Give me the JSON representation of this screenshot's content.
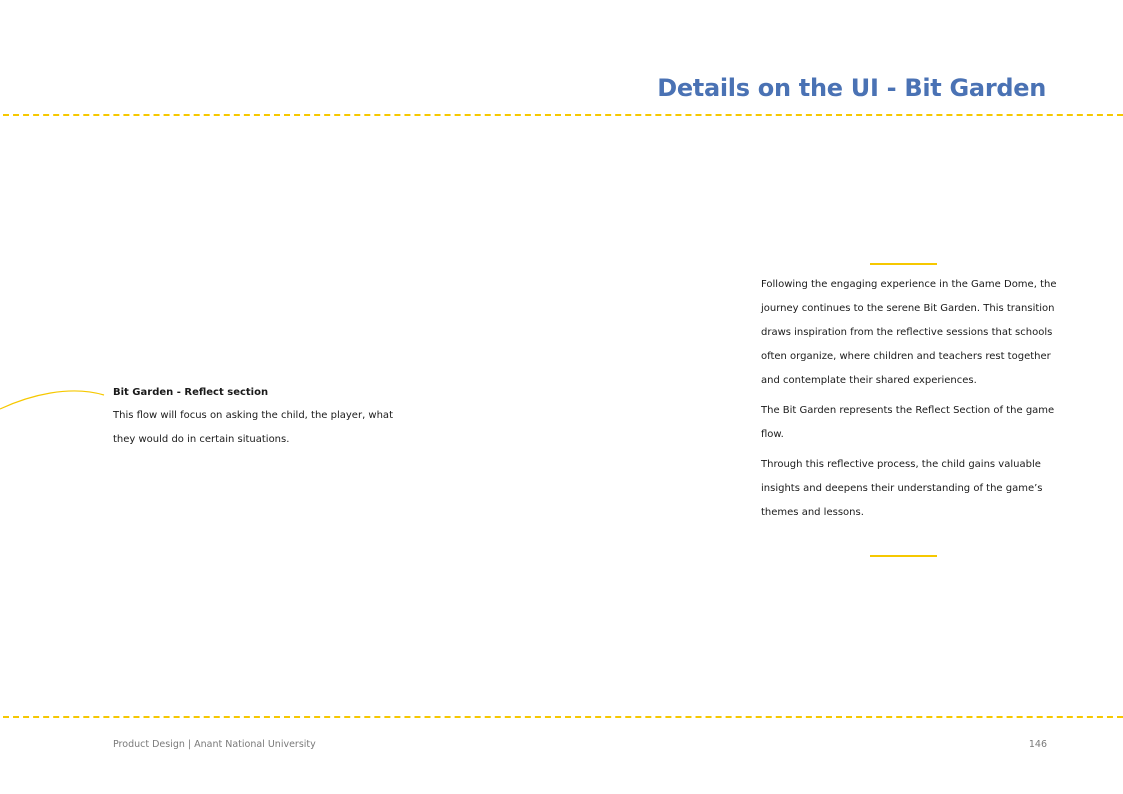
{
  "header": {
    "title": "Details on the UI - Bit Garden"
  },
  "left_note": {
    "heading": "Bit Garden - Reflect section",
    "body": "This flow will focus on asking the child, the player, what they would do in certain situations."
  },
  "right_text": {
    "paragraphs": [
      "Following the engaging experience in the Game Dome, the journey continues to the serene Bit Garden. This transition draws inspiration from the reflective sessions that schools often organize, where children and teachers rest together and contemplate their shared experiences.",
      "The Bit Garden represents the Reflect Section of the game flow.",
      "Through this reflective process, the child gains valuable insights and deepens their understanding of the game’s themes and lessons."
    ]
  },
  "footer": {
    "text": "Product Design | Anant National University",
    "page_number": "146"
  },
  "colors": {
    "title_blue": "#4a72b4",
    "accent_yellow": "#f6c800",
    "body_text": "#1a1a1a",
    "footer_grey": "#7a7a7a"
  }
}
